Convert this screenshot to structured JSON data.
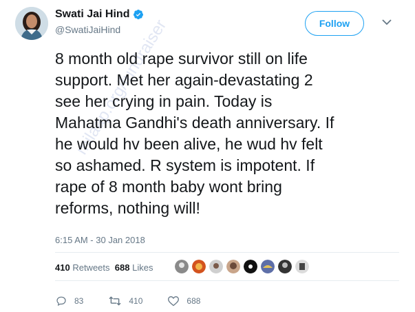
{
  "author": {
    "name": "Swati Jai Hind",
    "handle": "@SwatiJaiHind",
    "verified": true
  },
  "follow_button": {
    "label": "Follow"
  },
  "tweet": {
    "text": "8 month old rape survivor still on life\nsupport. Met her again-devastating 2\nsee her crying in pain. Today is\nMahatma Gandhi's death anniversary. If\nhe would hv been alive, he wud hv felt\nso ashamed. R system is impotent. If\nrape of 8 month baby wont bring\nreforms, nothing will!",
    "timestamp": "6:15 AM - 30 Jan 2018"
  },
  "stats": {
    "retweets_count": "410",
    "retweets_label": "Retweets",
    "likes_count": "688",
    "likes_label": "Likes"
  },
  "actions": {
    "reply_count": "83",
    "retweet_count": "410",
    "like_count": "688"
  },
  "watermark": "milaap.org/fundraiser",
  "colors": {
    "accent": "#1da1f2",
    "text": "#14171a",
    "muted": "#657786",
    "divider": "#e6ecf0"
  },
  "icons": [
    "verified-badge-icon",
    "chevron-down-icon",
    "reply-icon",
    "retweet-icon",
    "heart-icon"
  ]
}
